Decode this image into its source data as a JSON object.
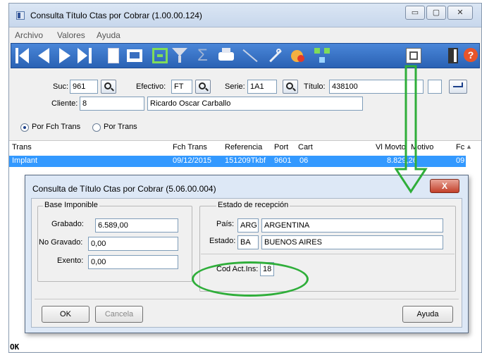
{
  "main_window": {
    "title": "Consulta Título Ctas por Cobrar (1.00.00.124)",
    "controls": {
      "minimize": "▭",
      "maximize": "▢",
      "close": "✕"
    }
  },
  "menu": [
    "Archivo",
    "Valores",
    "Ayuda"
  ],
  "form": {
    "suc_label": "Suc:",
    "suc_value": "961",
    "efectivo_label": "Efectivo:",
    "efectivo_value": "FT",
    "serie_label": "Serie:",
    "serie_value": "1A1",
    "titulo_label": "Título:",
    "titulo_value": "438100",
    "cliente_label": "Cliente:",
    "cliente_value": "8",
    "cliente_name": "Ricardo Oscar Carballo"
  },
  "radio": {
    "option1": "Por Fch Trans",
    "option2": "Por Trans",
    "selected": "option1"
  },
  "grid": {
    "headers": [
      "Trans",
      "Fch Trans",
      "Referencia",
      "Port",
      "Cart",
      "Vl Movto",
      "Motivo",
      "Fc"
    ],
    "rows": [
      [
        "Implant",
        "09/12/2015",
        "151209Tkbf",
        "9601",
        "06",
        "8.829,26",
        "",
        "09"
      ]
    ]
  },
  "dialog": {
    "title": "Consulta de Título Ctas por Cobrar (5.06.00.004)",
    "close_label": "X",
    "base_group": {
      "title": "Base Imponible",
      "grabado_label": "Grabado:",
      "grabado_value": "6.589,00",
      "no_gravado_label": "No Gravado:",
      "no_gravado_value": "0,00",
      "exento_label": "Exento:",
      "exento_value": "0,00"
    },
    "estado_group": {
      "title": "Estado de recepción",
      "pais_label": "País:",
      "pais_code": "ARG",
      "pais_name": "ARGENTINA",
      "estado_label": "Estado:",
      "estado_code": "BA",
      "estado_name": "BUENOS AIRES",
      "cod_label": "Cod Act.Ins:",
      "cod_value": "18"
    },
    "ok_label": "OK",
    "cancel_label": "Cancela",
    "help_label": "Ayuda"
  },
  "status_text": "OK",
  "colors": {
    "toolbar": "#2a62b4",
    "selection": "#3399ff",
    "annotation": "#2fae3a",
    "dialog_close": "#c3402a"
  },
  "icons": [
    "first-record-icon",
    "previous-record-icon",
    "next-record-icon",
    "last-record-icon",
    "new-document-icon",
    "preview-icon",
    "bracket-icon",
    "filter-icon",
    "sigma-icon",
    "print-icon",
    "line-icon",
    "wrench-icon",
    "chart-icon",
    "network-icon",
    "document-icon",
    "exit-door-icon",
    "help-icon"
  ]
}
